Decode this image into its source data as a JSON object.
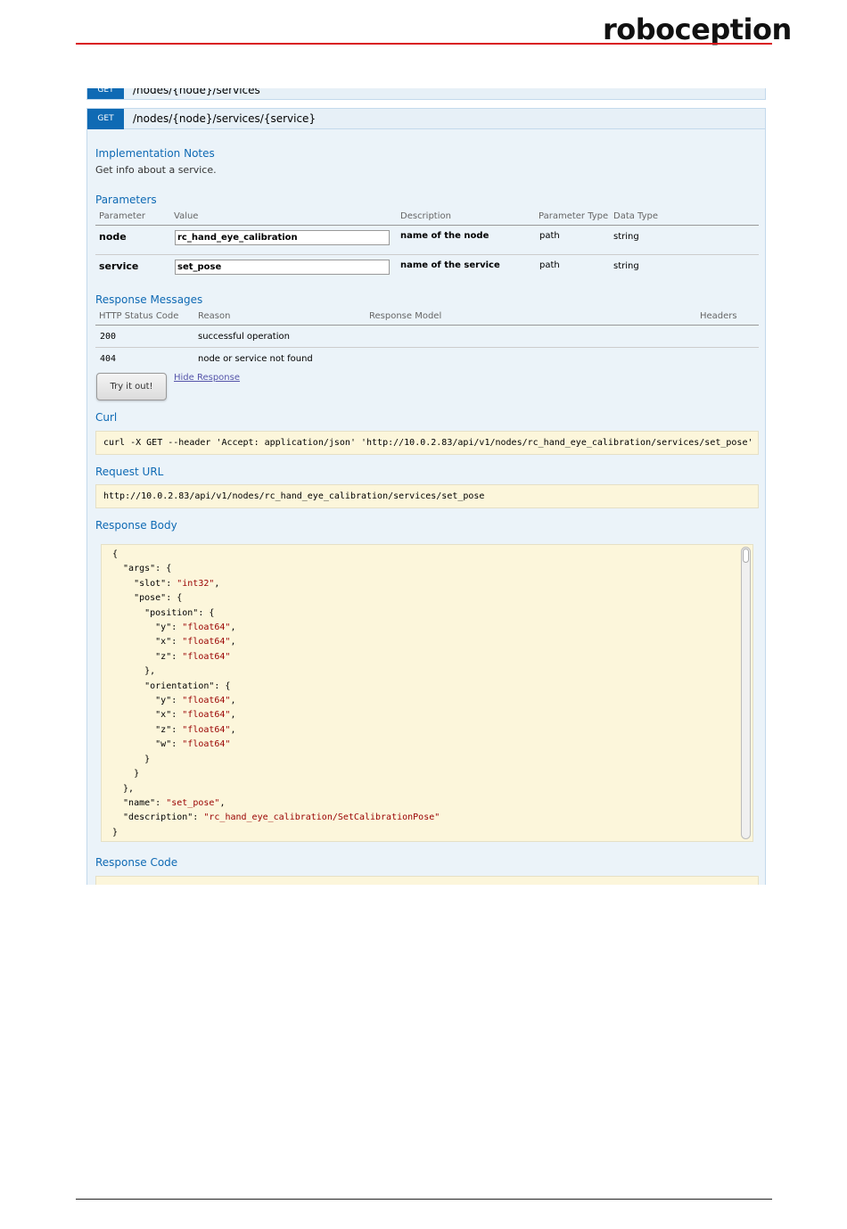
{
  "brand": {
    "logo_text": "roboception"
  },
  "previous_operation": {
    "method": "GET",
    "path": "/nodes/{node}/services"
  },
  "operation": {
    "method": "GET",
    "path": "/nodes/{node}/services/{service}",
    "implementation_notes_title": "Implementation Notes",
    "implementation_notes": "Get info about a service.",
    "parameters_title": "Parameters",
    "parameter_headers": [
      "Parameter",
      "Value",
      "Description",
      "Parameter Type",
      "Data Type"
    ],
    "parameters": [
      {
        "name": "node",
        "value": "rc_hand_eye_calibration",
        "description": "name of the node",
        "type": "path",
        "data_type": "string"
      },
      {
        "name": "service",
        "value": "set_pose",
        "description": "name of the service",
        "type": "path",
        "data_type": "string"
      }
    ],
    "response_messages_title": "Response Messages",
    "response_headers": [
      "HTTP Status Code",
      "Reason",
      "Response Model",
      "Headers"
    ],
    "responses": [
      {
        "code": "200",
        "reason": "successful operation"
      },
      {
        "code": "404",
        "reason": "node or service not found"
      }
    ],
    "try_button": "Try it out!",
    "hide_response": "Hide Response",
    "curl_title": "Curl",
    "curl": "curl -X GET --header 'Accept: application/json' 'http://10.0.2.83/api/v1/nodes/rc_hand_eye_calibration/services/set_pose'",
    "request_url_title": "Request URL",
    "request_url": "http://10.0.2.83/api/v1/nodes/rc_hand_eye_calibration/services/set_pose",
    "response_body_title": "Response Body",
    "response_body_lines": [
      "{",
      "  \"args\": {",
      "    \"slot\": \"int32\",",
      "    \"pose\": {",
      "      \"position\": {",
      "        \"y\": \"float64\",",
      "        \"x\": \"float64\",",
      "        \"z\": \"float64\"",
      "      },",
      "      \"orientation\": {",
      "        \"y\": \"float64\",",
      "        \"x\": \"float64\",",
      "        \"z\": \"float64\",",
      "        \"w\": \"float64\"",
      "      }",
      "    }",
      "  },",
      "  \"name\": \"set_pose\",",
      "  \"description\": \"rc_hand_eye_calibration/SetCalibrationPose\"",
      "}"
    ],
    "response_code_title": "Response Code"
  },
  "colors": {
    "accent": "#0f6ab4",
    "brand_rule": "#d9161c",
    "code_bg": "#fcf6db",
    "json_string": "#990000"
  }
}
